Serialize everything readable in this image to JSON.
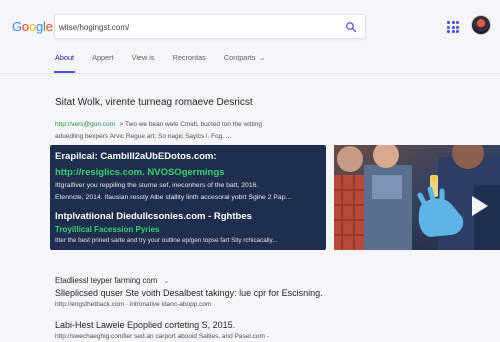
{
  "header": {
    "logo_letters": [
      {
        "ch": "G",
        "color": "#4285f4"
      },
      {
        "ch": "o",
        "color": "#ea4335"
      },
      {
        "ch": "o",
        "color": "#fbbc05"
      },
      {
        "ch": "g",
        "color": "#4285f4"
      },
      {
        "ch": "l",
        "color": "#34a853"
      },
      {
        "ch": "e",
        "color": "#ea4335"
      }
    ],
    "search_value": "witse/hogingst.com/"
  },
  "tabs": [
    {
      "label": "About",
      "active": true
    },
    {
      "label": "Appert",
      "active": false
    },
    {
      "label": "View is",
      "active": false
    },
    {
      "label": "Recrontas",
      "active": false
    },
    {
      "label": "Contparts",
      "active": false,
      "has_dropdown": true
    }
  ],
  "result1": {
    "title": "Sitat Wolk, virente turneag romaeve Desricst",
    "url": "http://vers@gun.com",
    "url_suffix": "> Two we bean wele Cmidl, bucted ton the witting",
    "snippet": "aduedling bexpers Arvic Regue art; So nagic Saylcs l. Fog. ..."
  },
  "card": {
    "title": "Erapilcai: Cambill2aUbEDotos.com:",
    "green_url": "http://resiglics.com. NVOSOgermings",
    "line1": "Ittgralfiver you reppiling the sturne sef, ineconhers of the batt, 2016.",
    "line2": "Etenncte, 2014. Ifausian ressty Albe stallity linth accesoral yobrt Sgine 2 Pap...",
    "title2": "Intplvatiional Diedullcsonies.com - Rghtbes",
    "green2": "Troyillical Facession Pyries",
    "small": "Itter the best prined sarte and try your outline ep/gen topse fart Sity rchicacally..."
  },
  "result2": {
    "title": "Etadliessl teyper farming com",
    "subtitle": "Slleplicsed quser Ste voith Desalbest takingy: lue cpr for Escisning.",
    "url": "http://engsthetback.com · intronative idanc-abopp.com"
  },
  "result3": {
    "title": "Labi-Hest Lawele Epoplied corteting S, 2015.",
    "url": "http://swechaeghig.comfier sed.an carport abooid Salties, and Pasel.com -"
  },
  "colors": {
    "accent": "#4c5bd4",
    "card_bg": "#1f2d4e",
    "url_green": "#1e8e3e",
    "card_green": "#34d36a"
  },
  "icons": {
    "search": "search-icon",
    "apps": "apps-grid-icon",
    "play": "play-icon",
    "chevron": "chevron-down-icon"
  }
}
